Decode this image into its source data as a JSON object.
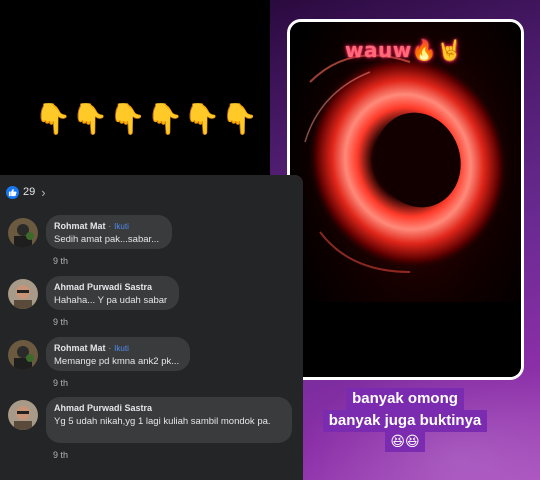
{
  "top": {
    "emoji_row": "👇👇👇👇👇👇"
  },
  "video": {
    "overlay_text": "wauw🔥🤘"
  },
  "comments_panel": {
    "reaction_count": "29",
    "comments": [
      {
        "author": "Rohmat Mat",
        "follow": "Ikuti",
        "text": "Sedih amat pak...sabar...",
        "time": "9 th"
      },
      {
        "author": "Ahmad Purwadi Sastra",
        "follow": "",
        "text": "Hahaha... Y pa udah sabar",
        "time": "9 th"
      },
      {
        "author": "Rohmat Mat",
        "follow": "Ikuti",
        "text": "Memange pd kmna ank2 pk...",
        "time": "9 th"
      },
      {
        "author": "Ahmad Purwadi Sastra",
        "follow": "",
        "text": "Yg 5 udah nikah,yg 1 lagi kuliah sambil mondok pa.",
        "time": "9 th"
      }
    ]
  },
  "caption": {
    "line1": "banyak omong",
    "line2": "banyak juga buktinya",
    "line3": "😆😆"
  },
  "colors": {
    "panel_bg": "#242526",
    "bubble_bg": "#3a3b3c",
    "like_blue": "#1877f2",
    "caption_bg": "#7b2bb0"
  },
  "icons": [
    "like-icon",
    "chevron-right-icon",
    "avatar"
  ]
}
